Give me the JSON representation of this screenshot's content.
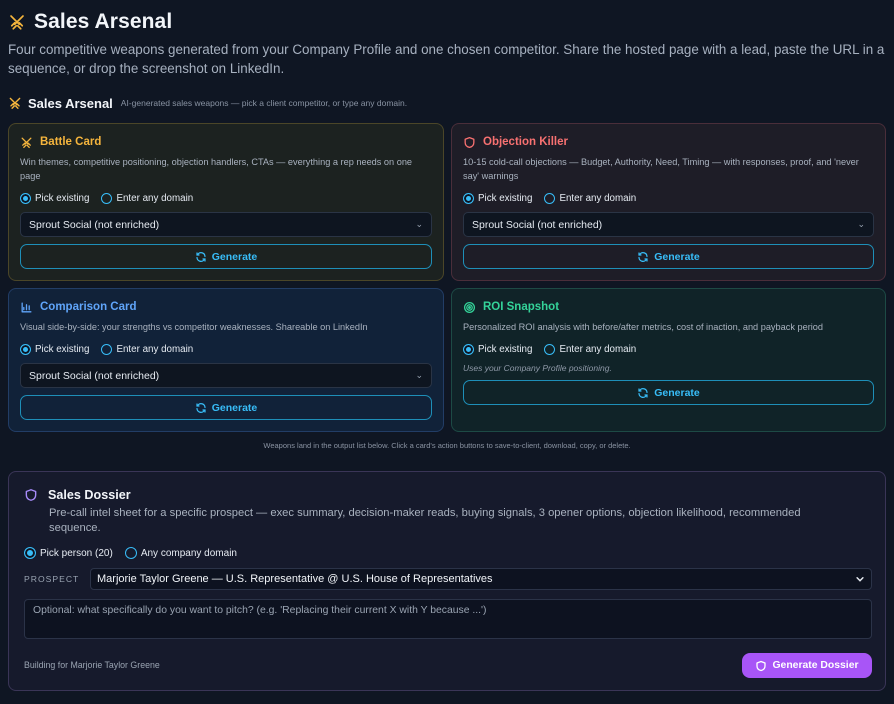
{
  "header": {
    "title": "Sales Arsenal",
    "intro": "Four competitive weapons generated from your Company Profile and one chosen competitor. Share the hosted page with a lead, paste the URL in a sequence, or drop the screenshot on LinkedIn."
  },
  "section": {
    "label": "Sales Arsenal",
    "hint": "AI-generated sales weapons — pick a client competitor, or type any domain."
  },
  "cards": {
    "battle": {
      "title": "Battle Card",
      "desc": "Win themes, competitive positioning, objection handlers, CTAs — everything a rep needs on one page",
      "pick": "Pick existing",
      "enter": "Enter any domain",
      "select": "Sprout Social (not enriched)",
      "generate": "Generate"
    },
    "objection": {
      "title": "Objection Killer",
      "desc": "10-15 cold-call objections — Budget, Authority, Need, Timing — with responses, proof, and 'never say' warnings",
      "pick": "Pick existing",
      "enter": "Enter any domain",
      "select": "Sprout Social (not enriched)",
      "generate": "Generate"
    },
    "compare": {
      "title": "Comparison Card",
      "desc": "Visual side-by-side: your strengths vs competitor weaknesses. Shareable on LinkedIn",
      "pick": "Pick existing",
      "enter": "Enter any domain",
      "select": "Sprout Social (not enriched)",
      "generate": "Generate"
    },
    "roi": {
      "title": "ROI Snapshot",
      "desc": "Personalized ROI analysis with before/after metrics, cost of inaction, and payback period",
      "pick": "Pick existing",
      "enter": "Enter any domain",
      "note": "Uses your Company Profile positioning.",
      "generate": "Generate"
    }
  },
  "footnote": "Weapons land in the output list below. Click a card's action buttons to save-to-client, download, copy, or delete.",
  "dossier": {
    "title": "Sales Dossier",
    "desc": "Pre-call intel sheet for a specific prospect — exec summary, decision-maker reads, buying signals, 3 opener options, objection likelihood, recommended sequence.",
    "pick_person": "Pick person (20)",
    "any_domain": "Any company domain",
    "prospect_label": "PROSPECT",
    "prospect_value": "Marjorie Taylor Greene — U.S. Representative @ U.S. House of Representatives",
    "pitch_placeholder": "Optional: what specifically do you want to pitch? (e.g. 'Replacing their current X with Y because ...')",
    "building_for": "Building for Marjorie Taylor Greene",
    "button": "Generate Dossier"
  },
  "colors": {
    "battle": "#f5b53d",
    "objection": "#f87171",
    "compare": "#60a5fa",
    "roi": "#34d399",
    "accent": "#38bdf8",
    "dossier_button": "#a855f7"
  }
}
